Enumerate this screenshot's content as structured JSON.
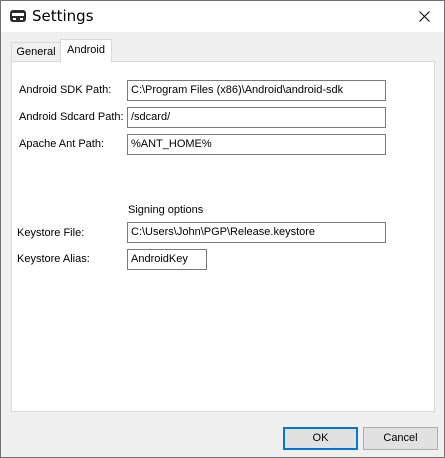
{
  "window": {
    "title": "Settings",
    "icon": "app-logo-icon"
  },
  "tabs": [
    {
      "label": "General",
      "selected": false
    },
    {
      "label": "Android",
      "selected": true
    }
  ],
  "android": {
    "sdk_path_label": "Android SDK Path:",
    "sdk_path_value": "C:\\Program Files (x86)\\Android\\android-sdk",
    "sdcard_path_label": "Android Sdcard Path:",
    "sdcard_path_value": "/sdcard/",
    "ant_path_label": "Apache Ant Path:",
    "ant_path_value": "%ANT_HOME%",
    "signing_heading": "Signing options",
    "keystore_file_label": "Keystore File:",
    "keystore_file_value": "C:\\Users\\John\\PGP\\Release.keystore",
    "keystore_alias_label": "Keystore Alias:",
    "keystore_alias_value": "AndroidKey"
  },
  "buttons": {
    "ok_label": "OK",
    "cancel_label": "Cancel"
  },
  "colors": {
    "focus_border": "#0078d7",
    "panel_bg": "#ffffff",
    "window_bg": "#f0f0f0"
  }
}
